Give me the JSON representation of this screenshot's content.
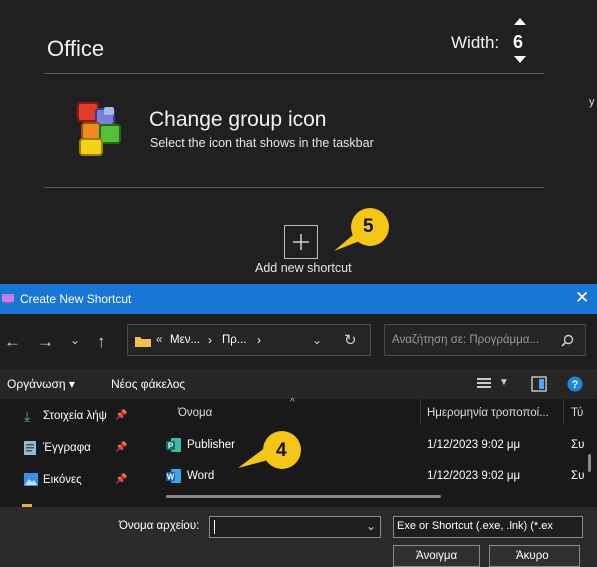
{
  "app": {
    "group_title": "Office",
    "width_label": "Width:",
    "width_value": "6",
    "group_icon": {
      "title": "Change group icon",
      "subtitle": "Select the icon that shows in the taskbar",
      "icon": "office-icon"
    },
    "add_shortcut_label": "Add new shortcut",
    "callout_5": "5",
    "side_edge_text": "y"
  },
  "dialog": {
    "title": "Create New Shortcut",
    "address": {
      "segments": [
        "«",
        "Μεν...",
        "›",
        "Πρ...",
        "›"
      ]
    },
    "search_placeholder": "Αναζήτηση σε: Προγράμμα...",
    "commands": {
      "organize": "Οργάνωση ▾",
      "new_folder": "Νέος φάκελος"
    },
    "nav_items": [
      {
        "label": "Στοιχεία λήψ",
        "icon": "download-icon"
      },
      {
        "label": "Έγγραφα",
        "icon": "documents-icon"
      },
      {
        "label": "Εικόνες",
        "icon": "pictures-icon"
      }
    ],
    "columns": {
      "name": "Όνομα",
      "date": "Ημερομηνία τροποποί...",
      "type": "Τύ"
    },
    "files": [
      {
        "name": "Publisher",
        "date": "1/12/2023 9:02 μμ",
        "type": "Συ",
        "icon": "publisher-icon"
      },
      {
        "name": "Word",
        "date": "1/12/2023 9:02 μμ",
        "type": "Συ",
        "icon": "word-icon"
      }
    ],
    "callout_4": "4",
    "filename_label": "Όνομα αρχείου:",
    "filename_value": "",
    "filetype": "Exe or Shortcut (.exe, .lnk) (*.ex",
    "open_label": "Άνοιγμα",
    "cancel_label": "Άκυρο"
  },
  "colors": {
    "titlebar": "#1976d2",
    "callout": "#f5c518",
    "background": "#202020"
  }
}
